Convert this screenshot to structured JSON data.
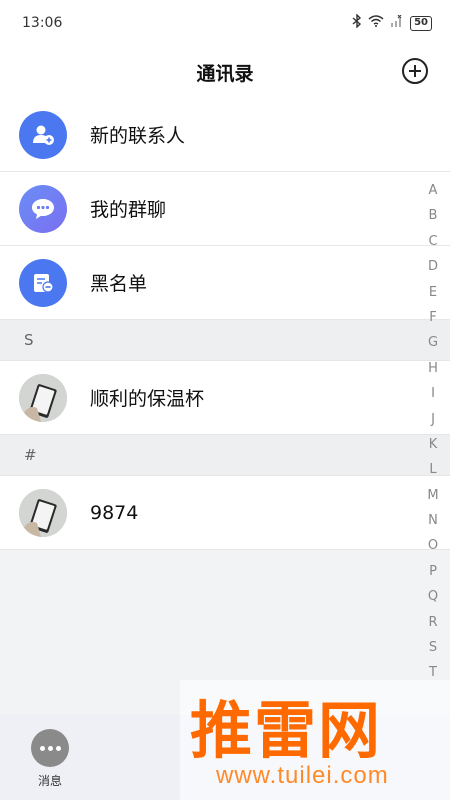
{
  "status_bar": {
    "time": "13:06",
    "icons": [
      "bluetooth-icon",
      "wifi-icon",
      "signal-icon",
      "battery-icon"
    ],
    "battery": "50"
  },
  "header": {
    "title": "通讯录",
    "add_icon": "plus-circle-icon"
  },
  "quick_items": [
    {
      "label": "新的联系人",
      "icon": "add-contact-icon",
      "color": "#4b78f0"
    },
    {
      "label": "我的群聊",
      "icon": "group-chat-icon",
      "color": "#6d7ef5"
    },
    {
      "label": "黑名单",
      "icon": "blacklist-icon",
      "color": "#4b78f0"
    }
  ],
  "sections": [
    {
      "letter": "S",
      "contacts": [
        {
          "name": "顺利的保温杯"
        }
      ]
    },
    {
      "letter": "#",
      "contacts": [
        {
          "name": "9874"
        }
      ]
    }
  ],
  "index_letters": [
    "A",
    "B",
    "C",
    "D",
    "E",
    "F",
    "G",
    "H",
    "I",
    "J",
    "K",
    "L",
    "M",
    "N",
    "O",
    "P",
    "Q",
    "R",
    "S",
    "T"
  ],
  "bottom_nav": {
    "messages_label": "消息",
    "messages_icon": "more-dots-icon"
  },
  "watermark": {
    "brand": "推雷网",
    "url": "www.tuilei.com"
  }
}
